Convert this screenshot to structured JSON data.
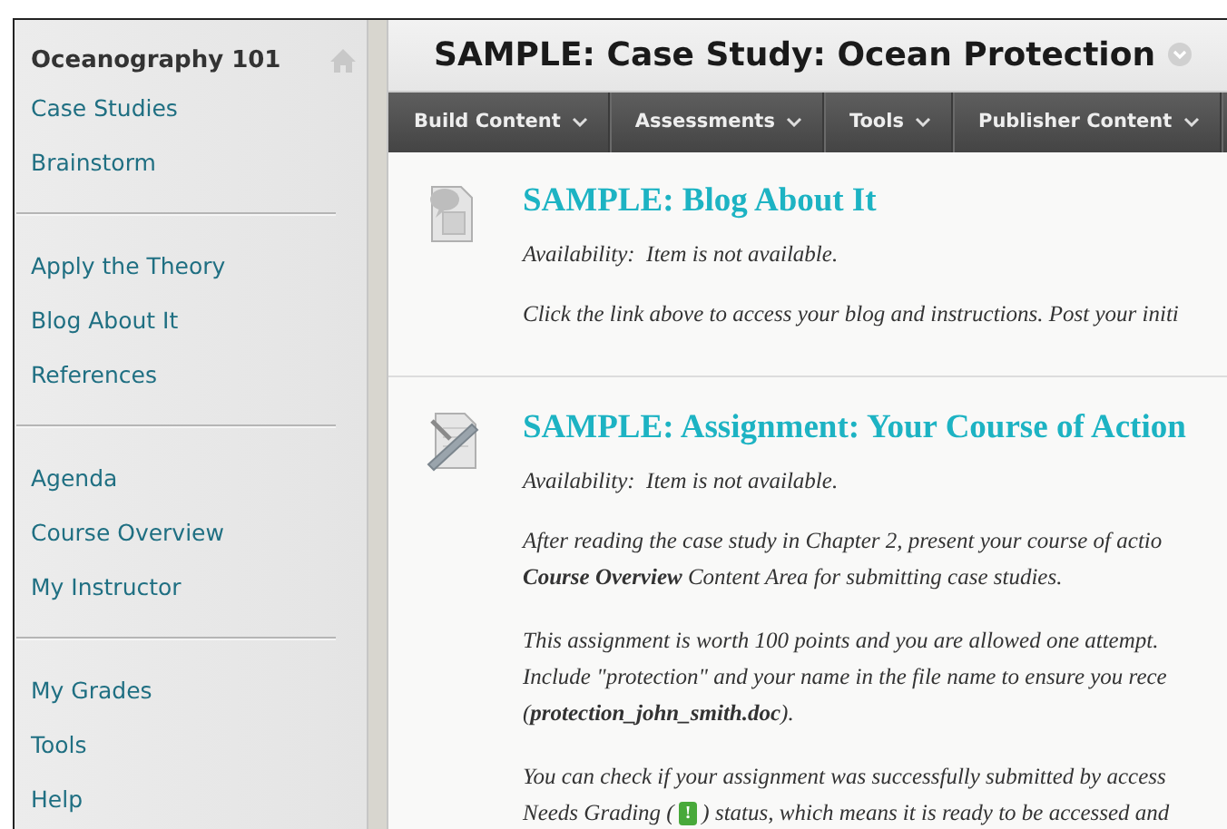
{
  "sidebar": {
    "course_title": "Oceanography 101",
    "groups": [
      [
        "Case Studies",
        "Brainstorm"
      ],
      [
        "Apply the Theory",
        "Blog About It",
        "References"
      ],
      [
        "Agenda",
        "Course Overview",
        "My Instructor"
      ],
      [
        "My Grades",
        "Tools",
        "Help"
      ]
    ]
  },
  "page": {
    "title": "SAMPLE: Case Study: Ocean Protection"
  },
  "menu": [
    "Build Content",
    "Assessments",
    "Tools",
    "Publisher Content"
  ],
  "content_items": [
    {
      "kind": "blog",
      "title": "SAMPLE: Blog About It",
      "availability": "Availability:  Item is not available.",
      "paragraphs": [
        [
          [
            {
              "kind": "text",
              "text": "Click the link above to access your blog and instructions. Post your initi"
            }
          ]
        ]
      ]
    },
    {
      "kind": "assignment",
      "title": "SAMPLE: Assignment: Your Course of Action",
      "availability": "Availability:  Item is not available.",
      "paragraphs": [
        [
          [
            {
              "kind": "text",
              "text": "After reading the case study in Chapter 2, present your course of actio"
            }
          ],
          [
            {
              "kind": "text",
              "text": "**Course Overview** Content Area for submitting case studies."
            }
          ]
        ],
        [
          [
            {
              "kind": "text",
              "text": "This assignment is worth 100 points and you are allowed one attempt."
            }
          ],
          [
            {
              "kind": "text",
              "text": "Include \"protection\" and your name in the file name to ensure you rece"
            }
          ],
          [
            {
              "kind": "text",
              "text": "(**protection_john_smith.doc**)."
            }
          ]
        ],
        [
          [
            {
              "kind": "text",
              "text": "You can check if your assignment was successfully submitted by access"
            }
          ],
          [
            {
              "kind": "text",
              "text": "Needs Grading ("
            },
            {
              "kind": "badge",
              "text": "!"
            },
            {
              "kind": "text",
              "text": ") status, which means it is ready to be accessed and"
            }
          ]
        ]
      ]
    }
  ]
}
